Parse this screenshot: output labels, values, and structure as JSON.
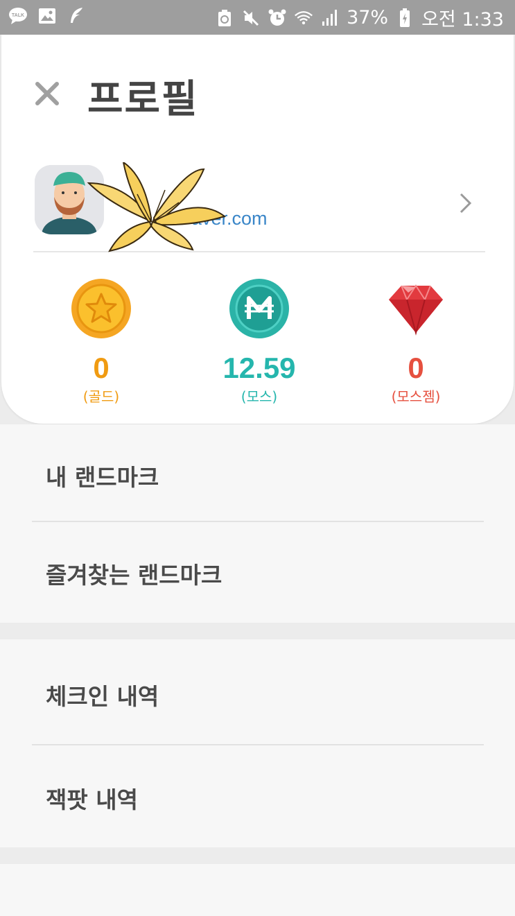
{
  "status_bar": {
    "battery_percent": "37%",
    "time": "오전 1:33",
    "left_icons": [
      "talk-icon",
      "gallery-icon",
      "feather-icon"
    ],
    "right_icons": [
      "recycle-icon",
      "mute-icon",
      "alarm-icon",
      "wifi-icon",
      "signal-icon",
      "battery-icon"
    ]
  },
  "header": {
    "title": "프로필"
  },
  "profile": {
    "email_visible": "aver.com"
  },
  "wallet": [
    {
      "amount": "0",
      "label": "(골드)",
      "color": "#f09b12",
      "icon": "gold-coin-icon"
    },
    {
      "amount": "12.59",
      "label": "(모스)",
      "color": "#25b6ad",
      "icon": "mos-coin-icon"
    },
    {
      "amount": "0",
      "label": "(모스젬)",
      "color": "#e6503f",
      "icon": "gem-icon"
    }
  ],
  "menu": {
    "section1": [
      "내 랜드마크",
      "즐겨찾는 랜드마크"
    ],
    "section2": [
      "체크인 내역",
      "잭팟 내역"
    ]
  }
}
